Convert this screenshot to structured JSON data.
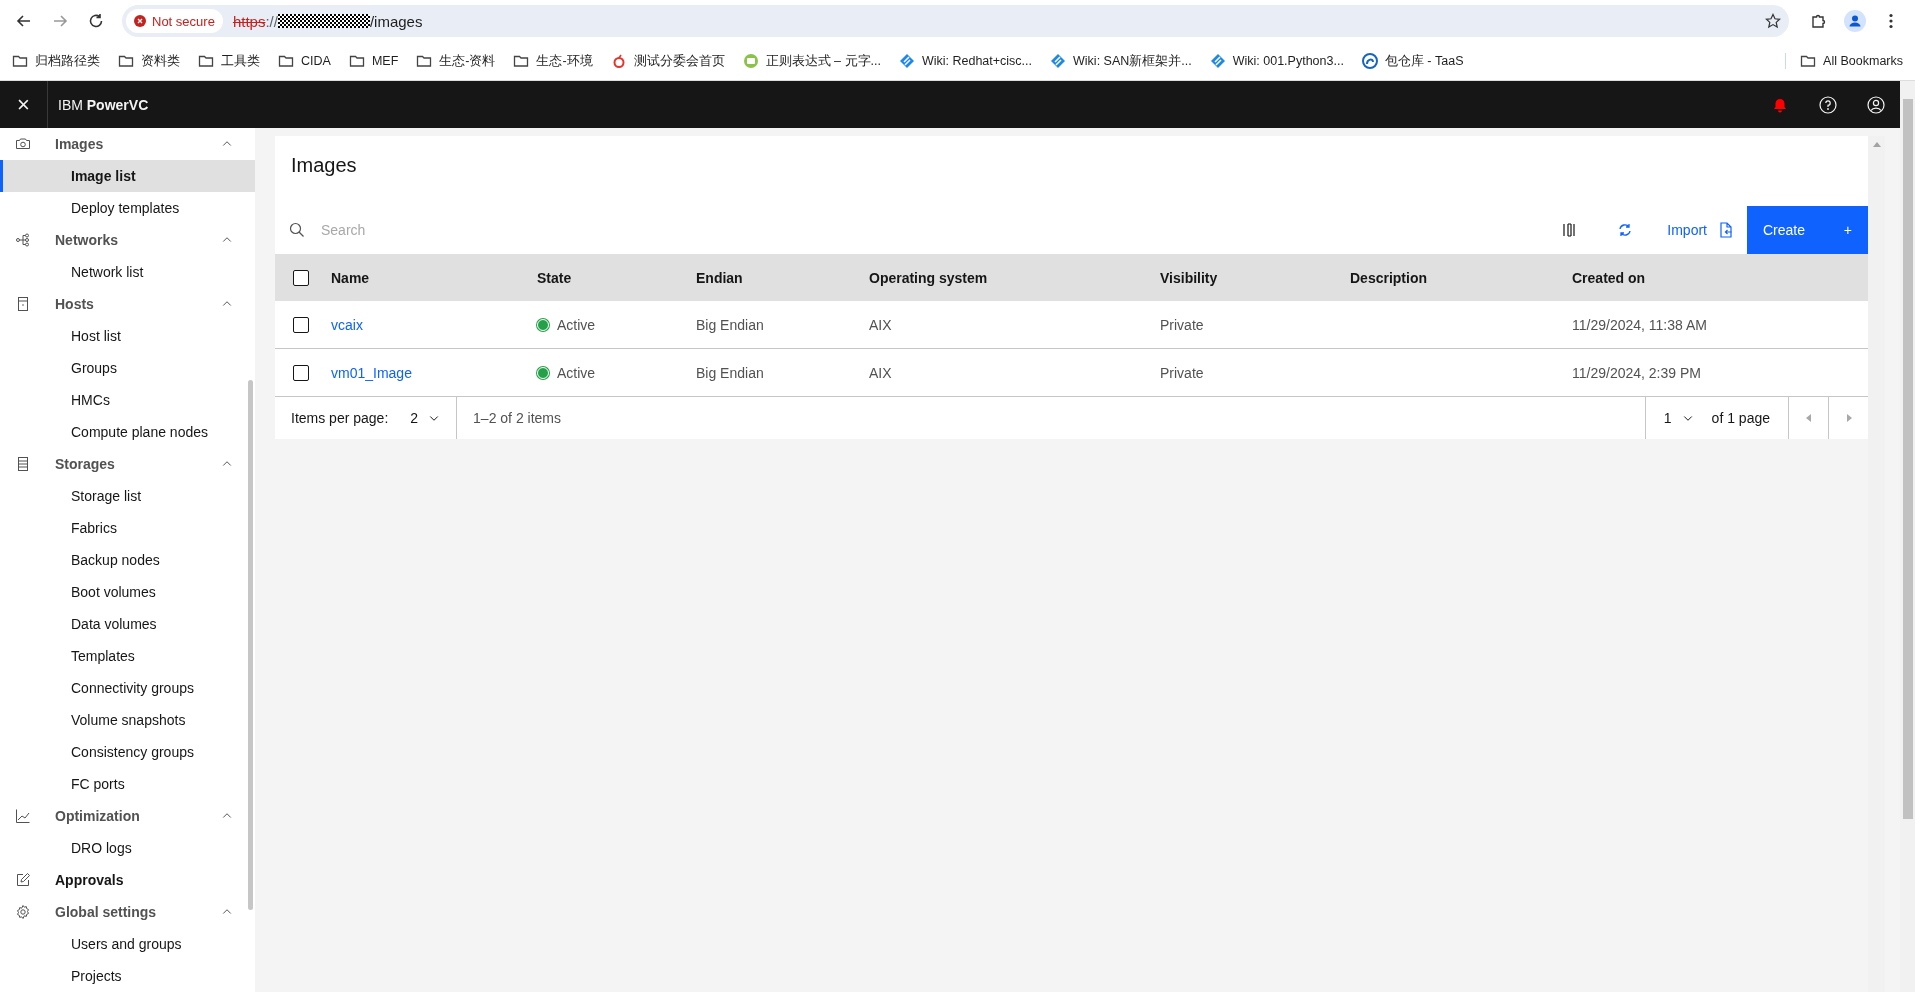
{
  "browser": {
    "security_label": "Not secure",
    "url": {
      "scheme": "https",
      "separator": "://",
      "path": "/images"
    },
    "bookmarks": [
      {
        "kind": "folder",
        "label": "归档路径类"
      },
      {
        "kind": "folder",
        "label": "资料类"
      },
      {
        "kind": "folder",
        "label": "工具类"
      },
      {
        "kind": "folder",
        "label": "CIDA"
      },
      {
        "kind": "folder",
        "label": "MEF"
      },
      {
        "kind": "folder",
        "label": "生态-资料"
      },
      {
        "kind": "folder",
        "label": "生态-环境"
      },
      {
        "kind": "fruit",
        "label": "测试分委会首页"
      },
      {
        "kind": "chat",
        "label": "正则表达式 – 元字..."
      },
      {
        "kind": "diamond",
        "label": "Wiki: Redhat+cisc..."
      },
      {
        "kind": "diamond",
        "label": "Wiki: SAN新框架并..."
      },
      {
        "kind": "diamond",
        "label": "Wiki: 001.Python3..."
      },
      {
        "kind": "swirl",
        "label": "包仓库 - TaaS"
      }
    ],
    "all_bookmarks": "All Bookmarks"
  },
  "app": {
    "title": "IBM **PowerVC**",
    "close_icon": "×",
    "notification_alert": true
  },
  "sidebar": {
    "items": [
      {
        "kind": "camera",
        "label": "Images",
        "expanded": true,
        "selected": false,
        "children": [
          {
            "label": "Image list",
            "selected": true
          },
          {
            "label": "Deploy templates",
            "selected": false
          }
        ]
      },
      {
        "kind": "network",
        "label": "Networks",
        "expanded": true,
        "selected": false,
        "children": [
          {
            "label": "Network list",
            "selected": false
          }
        ]
      },
      {
        "kind": "server",
        "label": "Hosts",
        "expanded": true,
        "selected": false,
        "children": [
          {
            "label": "Host list",
            "selected": false
          },
          {
            "label": "Groups",
            "selected": false
          },
          {
            "label": "HMCs",
            "selected": false
          },
          {
            "label": "Compute plane nodes",
            "selected": false
          }
        ]
      },
      {
        "kind": "storage",
        "label": "Storages",
        "expanded": true,
        "selected": false,
        "children": [
          {
            "label": "Storage list",
            "selected": false
          },
          {
            "label": "Fabrics",
            "selected": false
          },
          {
            "label": "Backup nodes",
            "selected": false
          },
          {
            "label": "Boot volumes",
            "selected": false
          },
          {
            "label": "Data volumes",
            "selected": false
          },
          {
            "label": "Templates",
            "selected": false
          },
          {
            "label": "Connectivity groups",
            "selected": false
          },
          {
            "label": "Volume snapshots",
            "selected": false
          },
          {
            "label": "Consistency groups",
            "selected": false
          },
          {
            "label": "FC ports",
            "selected": false
          }
        ]
      },
      {
        "kind": "chart",
        "label": "Optimization",
        "expanded": true,
        "selected": false,
        "children": [
          {
            "label": "DRO logs",
            "selected": false
          }
        ]
      },
      {
        "kind": "edit",
        "label": "Approvals",
        "selected": false
      },
      {
        "kind": "gear",
        "label": "Global settings",
        "expanded": true,
        "selected": false,
        "children": [
          {
            "label": "Users and groups",
            "selected": false
          },
          {
            "label": "Projects",
            "selected": false
          }
        ]
      }
    ]
  },
  "page": {
    "title": "Images",
    "search": {
      "placeholder": "Search"
    },
    "import_label": "Import",
    "create_label": "Create",
    "create_icon": "+"
  },
  "table": {
    "header_checked": false,
    "columns": [
      "Name",
      "State",
      "Endian",
      "Operating system",
      "Visibility",
      "Description",
      "Created on"
    ],
    "rows": [
      {
        "checked": false,
        "name": "vcaix",
        "state": "Active",
        "color": "#24a148",
        "endian": "Big Endian",
        "os": "AIX",
        "visibility": "Private",
        "created_on": "11/29/2024, 11:38 AM"
      },
      {
        "checked": false,
        "name": "vm01_Image",
        "state": "Active",
        "color": "#24a148",
        "endian": "Big Endian",
        "os": "AIX",
        "visibility": "Private",
        "created_on": "11/29/2024, 2:39 PM"
      }
    ]
  },
  "pagination": {
    "items_per_page_label": "Items per page:",
    "per_page": "2",
    "range": "1–2 of 2 items",
    "page": "1",
    "page_total": "of 1 page"
  }
}
